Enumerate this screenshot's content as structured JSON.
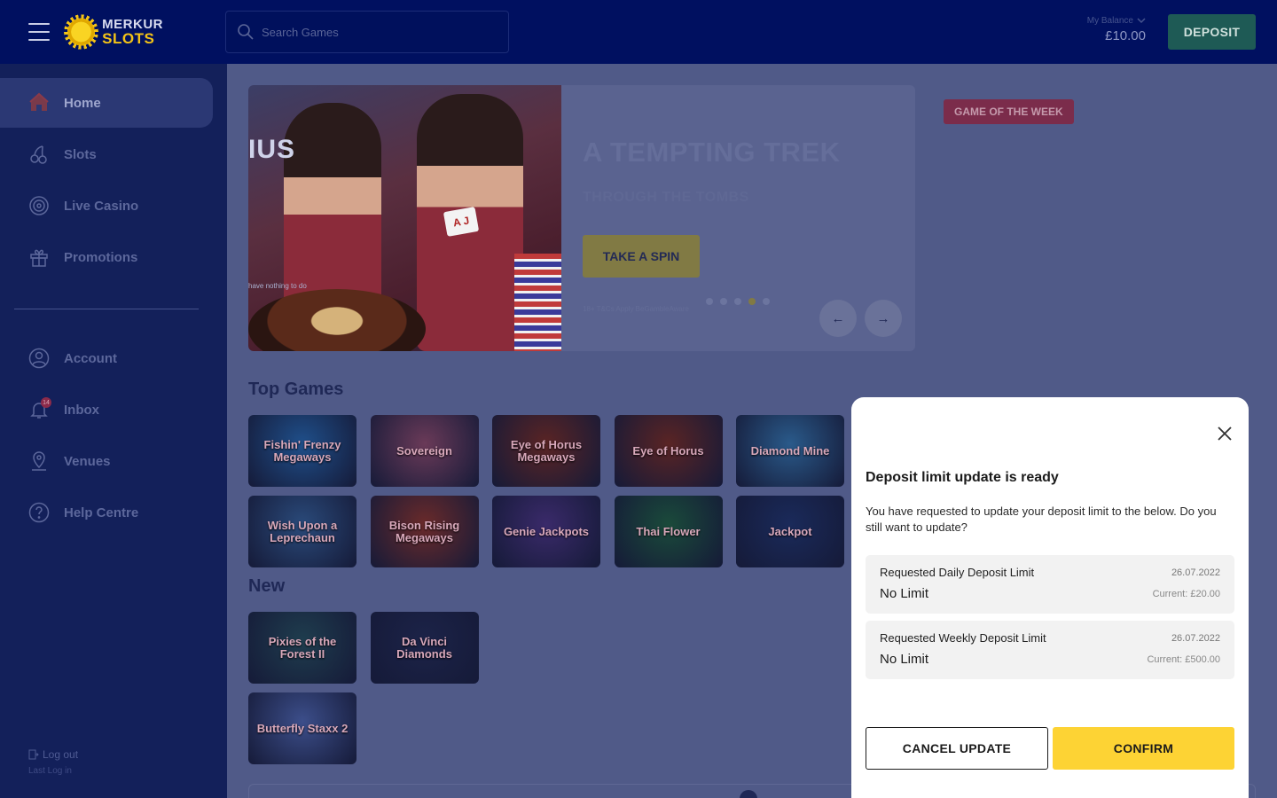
{
  "header": {
    "logo_line1": "MERKUR",
    "logo_line2": "SLOTS",
    "search_placeholder": "Search Games",
    "balance_label": "My Balance",
    "balance_value": "£10.00",
    "deposit_label": "DEPOSIT"
  },
  "sidebar": {
    "items": [
      {
        "label": "Home",
        "icon": "home-icon",
        "active": true
      },
      {
        "label": "Slots",
        "icon": "cherries-icon"
      },
      {
        "label": "Live Casino",
        "icon": "roulette-icon"
      },
      {
        "label": "Promotions",
        "icon": "gift-icon"
      },
      {
        "label": "Account",
        "icon": "user-icon"
      },
      {
        "label": "Inbox",
        "icon": "bell-icon",
        "badge": "14"
      },
      {
        "label": "Venues",
        "icon": "location-icon"
      },
      {
        "label": "Help Centre",
        "icon": "help-icon"
      }
    ],
    "logout_label": "Log out",
    "last_login_label": "Last Log in"
  },
  "hero": {
    "partial_title": "IUS",
    "tiny_text": "have nothing to do",
    "cards_text": "A J",
    "title": "A TEMPTING TREK",
    "subtitle": "THROUGH THE TOMBS",
    "cta": "TAKE A SPIN",
    "terms": "18+ T&Cs Apply BeGambleAware",
    "prev_arrow": "←",
    "next_arrow": "→",
    "active_dot": 3,
    "dot_count": 5
  },
  "game_of_week_label": "GAME OF THE WEEK",
  "sections": {
    "top_games_title": "Top Games",
    "new_title": "New"
  },
  "top_games": [
    {
      "name": "Fishin' Frenzy Megaways",
      "bg": "#1f4f8a"
    },
    {
      "name": "Sovereign",
      "bg": "#6a3a58"
    },
    {
      "name": "Eye of Horus Megaways",
      "bg": "#5a2424"
    },
    {
      "name": "Eye of Horus",
      "bg": "#5a2424"
    },
    {
      "name": "Diamond Mine",
      "bg": "#2a5a8a"
    },
    {
      "name": "Wish Upon a Leprechaun",
      "bg": "#2a4a7a"
    },
    {
      "name": "Bison Rising Megaways",
      "bg": "#6a2a2a"
    },
    {
      "name": "Genie Jackpots",
      "bg": "#3a2a6a"
    },
    {
      "name": "Thai Flower",
      "bg": "#1a4a3a"
    },
    {
      "name": "Jackpot",
      "bg": "#1a2a5a"
    }
  ],
  "new_games": [
    {
      "name": "Pixies of the Forest II",
      "bg": "#1f3d4e"
    },
    {
      "name": "Da Vinci Diamonds",
      "bg": "#1c2348"
    },
    {
      "name": "Butterfly Staxx 2",
      "bg": "#3c4e8a"
    }
  ],
  "modal": {
    "title": "Deposit limit update is ready",
    "text": "You have requested to update your deposit limit to the below. Do you still want to update?",
    "limits": [
      {
        "label": "Requested Daily Deposit Limit",
        "date": "26.07.2022",
        "value": "No Limit",
        "current": "Current: £20.00"
      },
      {
        "label": "Requested Weekly Deposit Limit",
        "date": "26.07.2022",
        "value": "No Limit",
        "current": "Current: £500.00"
      }
    ],
    "cancel_label": "CANCEL UPDATE",
    "confirm_label": "CONFIRM"
  },
  "colors": {
    "topbar": "#001060",
    "sidebar": "#13205a",
    "overlay_main": "#505a88",
    "confirm": "#fdd334",
    "deposit": "#1e5a55"
  }
}
